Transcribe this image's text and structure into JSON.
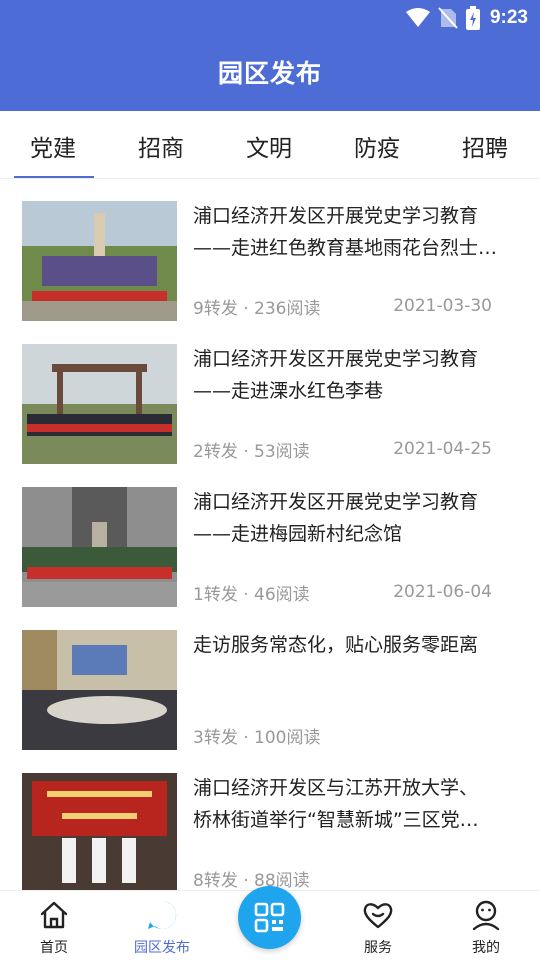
{
  "status_bar": {
    "time": "9:23"
  },
  "header": {
    "title": "园区发布"
  },
  "tabs": [
    {
      "label": "党建",
      "active": true
    },
    {
      "label": "招商",
      "active": false
    },
    {
      "label": "文明",
      "active": false
    },
    {
      "label": "防疫",
      "active": false
    },
    {
      "label": "招聘",
      "active": false
    }
  ],
  "articles": [
    {
      "title": "浦口经济开发区开展党史学习教育\n——走进红色教育基地雨花台烈士…",
      "meta": "9转发 · 236阅读",
      "date": "2021-03-30"
    },
    {
      "title": "浦口经济开发区开展党史学习教育\n——走进溧水红色李巷",
      "meta": "2转发 · 53阅读",
      "date": "2021-04-25"
    },
    {
      "title": "浦口经济开发区开展党史学习教育\n——走进梅园新村纪念馆",
      "meta": "1转发 · 46阅读",
      "date": "2021-06-04"
    },
    {
      "title": "走访服务常态化，贴心服务零距离",
      "meta": "3转发 · 100阅读",
      "date": ""
    },
    {
      "title": "浦口经济开发区与江苏开放大学、\n桥林街道举行“智慧新城”三区党…",
      "meta": "8转发 · 88阅读",
      "date": ""
    }
  ],
  "tabbar": {
    "home": "首页",
    "park_news": "园区发布",
    "service": "服务",
    "mine": "我的"
  },
  "colors": {
    "primary": "#4d6cd6",
    "scan_button": "#1ea5ee"
  }
}
